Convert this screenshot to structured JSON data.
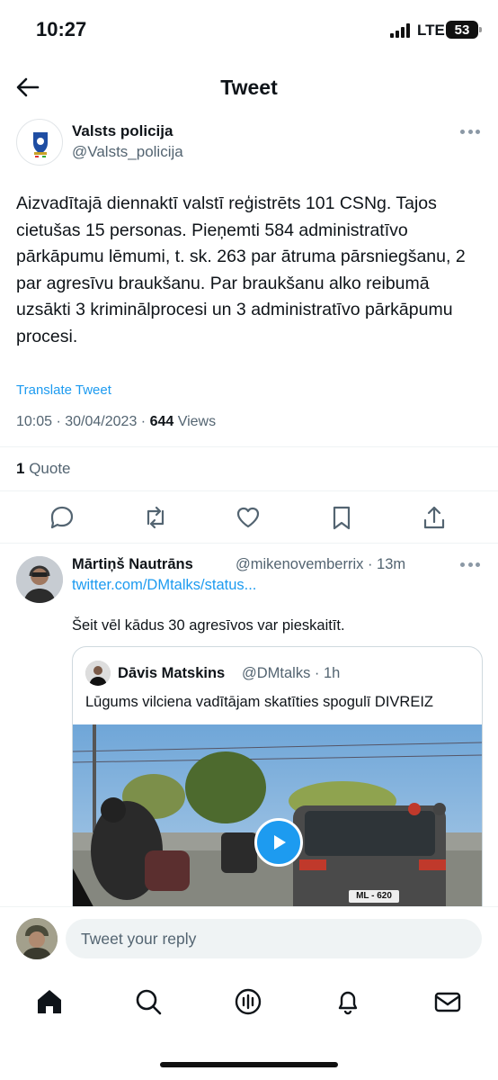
{
  "status_bar": {
    "time": "10:27",
    "network": "LTE",
    "battery": "53"
  },
  "header": {
    "title": "Tweet"
  },
  "tweet": {
    "author_name": "Valsts policija",
    "author_handle": "@Valsts_policija",
    "text": "Aizvadītajā diennaktī valstī reģistrēts 101 CSNg. Tajos cietušas 15 personas. Pieņemti 584 administratīvo pārkāpumu lēmumi, t. sk. 263 par ātruma pārsniegšanu, 2 par agresīvu braukšanu. Par braukšanu alko reibumā uzsākti 3 kriminālprocesi un 3 administratīvo pārkāpumu procesi.",
    "translate_label": "Translate Tweet",
    "timestamp": "10:05 · 30/04/2023 · ",
    "views_count": "644",
    "views_label": " Views",
    "quote_count": "1",
    "quote_label": " Quote"
  },
  "reply": {
    "author_name": "Mārtiņš Nautrāns",
    "author_handle_time": "@mikenovemberrix · 13m",
    "link": "twitter.com/DMtalks/status...",
    "text": "Šeit vēl kādus 30 agresīvos var pieskaitīt.",
    "quoted": {
      "author_name": "Dāvis Matskins",
      "author_handle_time": "@DMtalks · 1h",
      "text": "Lūgums vilciena vadītājam skatīties spogulī DIVREIZ",
      "plate": "ML - 620"
    }
  },
  "composer": {
    "placeholder": "Tweet your reply"
  },
  "icons": {
    "back": "arrow-left-icon",
    "reply": "comment-icon",
    "retweet": "retweet-icon",
    "like": "heart-icon",
    "bookmark": "bookmark-icon",
    "share": "share-icon",
    "home": "home-icon",
    "search": "search-icon",
    "spaces": "spaces-icon",
    "notifications": "bell-icon",
    "messages": "mail-icon"
  },
  "colors": {
    "accent": "#1d9bf0",
    "text": "#0f1419",
    "muted": "#536471",
    "divider": "#eff3f4"
  }
}
